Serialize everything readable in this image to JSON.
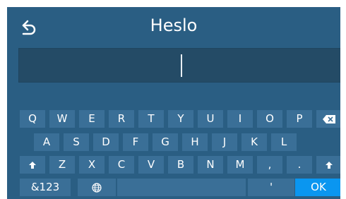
{
  "header": {
    "title": "Heslo",
    "back_icon": "back-arrow-icon"
  },
  "input": {
    "value": ""
  },
  "keyboard": {
    "row1": [
      "Q",
      "W",
      "E",
      "R",
      "T",
      "Y",
      "U",
      "I",
      "O",
      "P"
    ],
    "row2": [
      "A",
      "S",
      "D",
      "F",
      "G",
      "H",
      "J",
      "K",
      "L"
    ],
    "row3": [
      "Z",
      "X",
      "C",
      "V",
      "B",
      "N",
      "M",
      ",",
      "."
    ],
    "row4": {
      "numbers": "&123",
      "apostrophe": "'",
      "ok": "OK"
    },
    "icons": {
      "backspace": "backspace-icon",
      "shift": "shift-arrow-icon",
      "language": "globe-icon"
    }
  },
  "colors": {
    "screen": "#2a5e83",
    "key": "#3a6f97",
    "input": "#244b66",
    "ok": "#0a96f0",
    "text": "#ffffff"
  }
}
